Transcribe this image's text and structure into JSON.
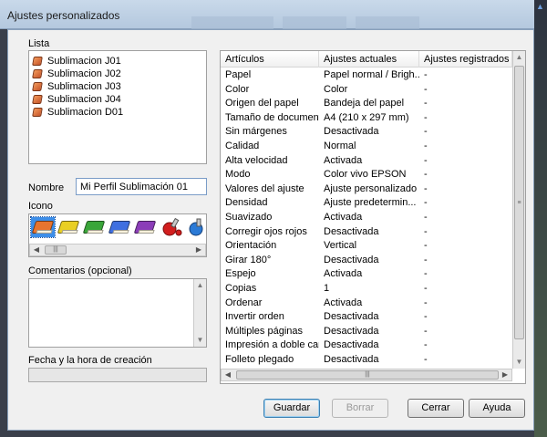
{
  "window": {
    "title": "Ajustes personalizados"
  },
  "lista": {
    "label": "Lista",
    "items": [
      "Sublimacion J01",
      "Sublimacion J02",
      "Sublimacion J03",
      "Sublimacion J04",
      "Sublimacion D01"
    ]
  },
  "nombre": {
    "label": "Nombre",
    "value": "Mi Perfil Sublimación 01"
  },
  "icono": {
    "label": "Icono",
    "colors": [
      "#e8742f",
      "#e9cf23",
      "#3aa63a",
      "#3f6fe0",
      "#8b3db8"
    ]
  },
  "comentarios": {
    "label": "Comentarios (opcional)"
  },
  "fecha": {
    "label": "Fecha y la hora de creación"
  },
  "table": {
    "columns": [
      "Artículos",
      "Ajustes actuales",
      "Ajustes registrados"
    ],
    "rows": [
      [
        "Papel",
        "Papel normal / Brigh...",
        "-"
      ],
      [
        "Color",
        "Color",
        "-"
      ],
      [
        "Origen del papel",
        "Bandeja del papel",
        "-"
      ],
      [
        "Tamaño de documento",
        "A4 (210 x 297 mm)",
        "-"
      ],
      [
        "Sin márgenes",
        "Desactivada",
        "-"
      ],
      [
        "Calidad",
        "Normal",
        "-"
      ],
      [
        "Alta velocidad",
        "Activada",
        "-"
      ],
      [
        "Modo",
        "Color vivo EPSON",
        "-"
      ],
      [
        "Valores del ajuste",
        "Ajuste personalizado",
        "-"
      ],
      [
        "Densidad",
        "Ajuste predetermin...",
        "-"
      ],
      [
        "Suavizado",
        "Activada",
        "-"
      ],
      [
        "Corregir ojos rojos",
        "Desactivada",
        "-"
      ],
      [
        "Orientación",
        "Vertical",
        "-"
      ],
      [
        "Girar 180°",
        "Desactivada",
        "-"
      ],
      [
        "Espejo",
        "Activada",
        "-"
      ],
      [
        "Copias",
        "1",
        "-"
      ],
      [
        "Ordenar",
        "Activada",
        "-"
      ],
      [
        "Invertir orden",
        "Desactivada",
        "-"
      ],
      [
        "Múltiples páginas",
        "Desactivada",
        "-"
      ],
      [
        "Impresión a doble cara",
        "Desactivada",
        "-"
      ],
      [
        "Folleto plegado",
        "Desactivada",
        "-"
      ]
    ]
  },
  "buttons": {
    "guardar": "Guardar",
    "borrar": "Borrar",
    "cerrar": "Cerrar",
    "ayuda": "Ayuda"
  }
}
